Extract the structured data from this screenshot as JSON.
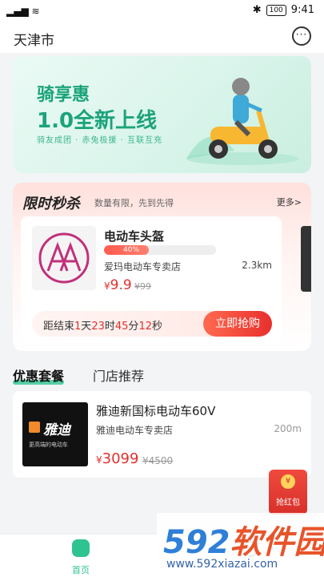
{
  "status_bar": {
    "signal": "▂▄▆ ≋",
    "bluetooth": "✱",
    "battery": "100",
    "time": "9:41"
  },
  "header": {
    "city": "天津市",
    "message_icon": "···"
  },
  "banner": {
    "line1": "骑享惠",
    "line2": "1.0全新上线",
    "line3": "骑友成团 · 赤兔极援 · 互联互充"
  },
  "flash_sale": {
    "title": "限时秒杀",
    "subtitle": "数量有限，先到先得",
    "more": "更多>",
    "product": {
      "name": "电动车头盔",
      "progress_label": "40%",
      "progress": 0.4,
      "store": "爱玛电动车专卖店",
      "distance": "2.3km",
      "currency": "¥",
      "price": "9.9",
      "old_price": "¥99"
    },
    "countdown": {
      "prefix": "距结束",
      "days": "1",
      "day_unit": "天",
      "hours": "23",
      "hour_unit": "时",
      "minutes": "45",
      "minute_unit": "分",
      "seconds": "12",
      "second_unit": "秒"
    },
    "buy_label": "立即抢购"
  },
  "tabs": [
    {
      "label": "优惠套餐"
    },
    {
      "label": "门店推荐"
    }
  ],
  "package": {
    "name": "雅迪新国标电动车60V",
    "store": "雅迪电动车专卖店",
    "distance": "200m",
    "currency": "¥",
    "price": "3099",
    "old_price": "¥4500",
    "brand_logo_text": "雅迪",
    "brand_slogan": "更高端的电动车"
  },
  "red_packet": {
    "coin": "¥",
    "label": "抢红包"
  },
  "bottom_nav": {
    "home": "首页"
  },
  "watermark": {
    "big_prefix": "592",
    "big_suffix": "软件园",
    "small": "www.592xiazai.com"
  },
  "colors": {
    "accent": "#2ec492",
    "price_red": "#e3302e",
    "brand_blue": "#2f7fd9"
  }
}
